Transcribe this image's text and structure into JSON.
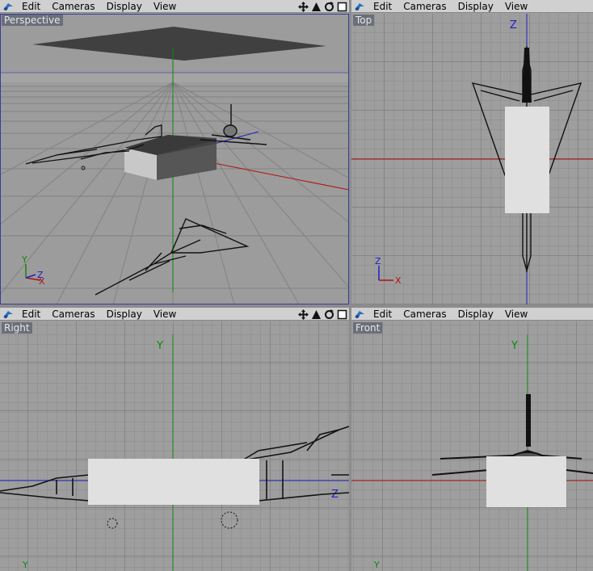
{
  "menus": [
    "Edit",
    "Cameras",
    "Display",
    "View"
  ],
  "viewports": {
    "perspective": {
      "label": "Perspective"
    },
    "top": {
      "label": "Top"
    },
    "right": {
      "label": "Right"
    },
    "front": {
      "label": "Front"
    }
  },
  "axis_labels": {
    "x": "X",
    "y": "Y",
    "z": "Z"
  },
  "icons": {
    "logo": "cinema4d-logo-icon",
    "move": "move-view-icon",
    "zoom": "zoom-view-icon",
    "rotate": "rotate-view-icon",
    "maximize": "maximize-view-icon"
  },
  "colors": {
    "menubar": "#d0d0d0",
    "viewport_bg": "#9e9e9e",
    "grid": "#8a8a8a",
    "grid_major": "#6f6f6f",
    "axis_x": "#b01010",
    "axis_y": "#0a8a0a",
    "axis_z": "#2020c0",
    "label_bg": "#6a6f7a"
  }
}
